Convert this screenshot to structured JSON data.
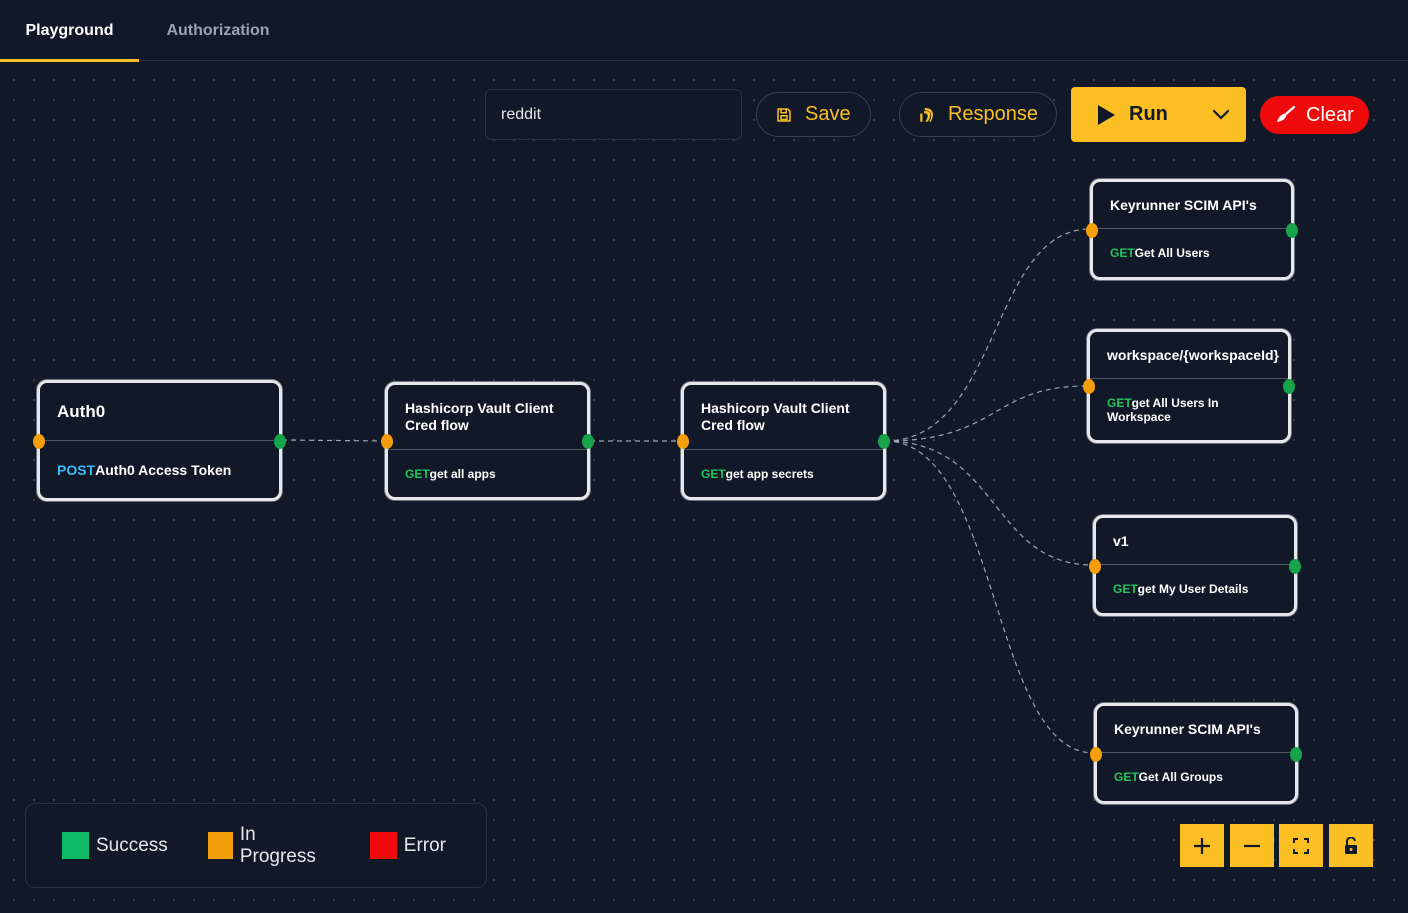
{
  "tabs": [
    {
      "label": "Playground",
      "active": true
    },
    {
      "label": "Authorization",
      "active": false
    }
  ],
  "toolbar": {
    "flow_name": "reddit",
    "save_label": "Save",
    "response_label": "Response",
    "run_label": "Run",
    "clear_label": "Clear"
  },
  "nodes": [
    {
      "title": "Auth0",
      "method": "POST",
      "endpoint": "Auth0 Access Token"
    },
    {
      "title": "Hashicorp Vault Client Cred flow",
      "method": "GET",
      "endpoint": "get all apps"
    },
    {
      "title": "Hashicorp Vault Client Cred flow",
      "method": "GET",
      "endpoint": "get app secrets"
    },
    {
      "title": "Keyrunner SCIM API's",
      "method": "GET",
      "endpoint": "Get All Users"
    },
    {
      "title": "workspace/{workspaceId}",
      "method": "GET",
      "endpoint": "get All Users In Workspace"
    },
    {
      "title": "v1",
      "method": "GET",
      "endpoint": "get My User Details"
    },
    {
      "title": "Keyrunner SCIM API's",
      "method": "GET",
      "endpoint": "Get All Groups"
    }
  ],
  "legend": [
    {
      "label": "Success",
      "color": "#10b966"
    },
    {
      "label": "In Progress",
      "color": "#f59e0b"
    },
    {
      "label": "Error",
      "color": "#ef0b0b"
    }
  ],
  "colors": {
    "accent": "#fbbf24",
    "background": "#111827",
    "get_method": "#22c55e",
    "post_method": "#38bdf8",
    "handle_in": "#f59e0b",
    "handle_out": "#16a34a",
    "danger": "#ef0b0b"
  },
  "controls": [
    {
      "icon": "plus-icon"
    },
    {
      "icon": "minus-icon"
    },
    {
      "icon": "fit-view-icon"
    },
    {
      "icon": "unlock-icon"
    }
  ]
}
